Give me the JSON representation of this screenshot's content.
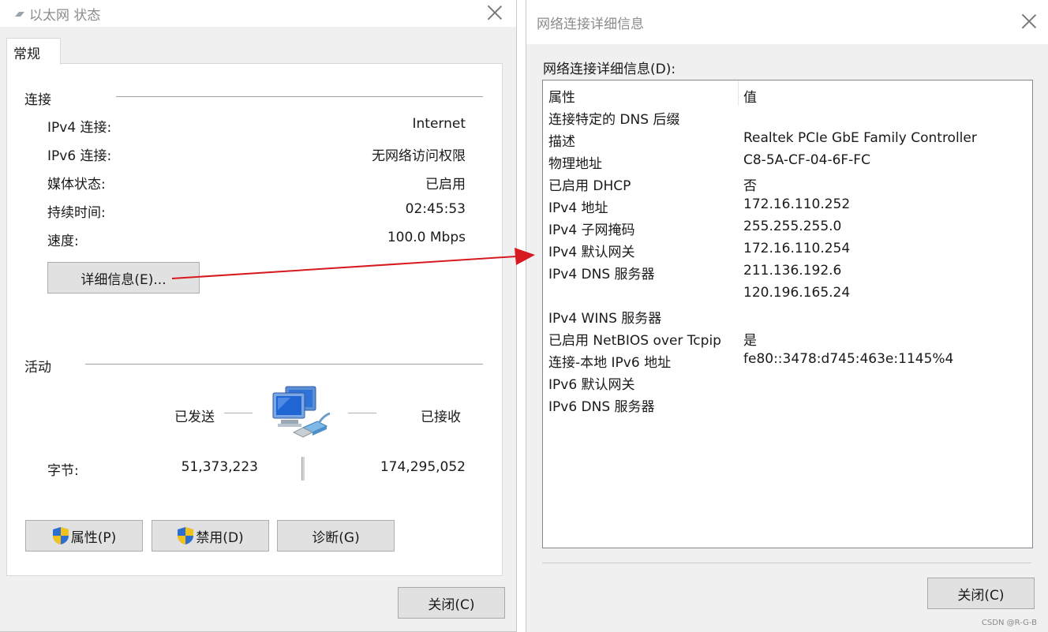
{
  "status_window": {
    "title": "以太网 状态",
    "tab_label": "常规",
    "connection": {
      "section_label": "连接",
      "rows": [
        {
          "label": "IPv4 连接:",
          "value": "Internet"
        },
        {
          "label": "IPv6 连接:",
          "value": "无网络访问权限"
        },
        {
          "label": "媒体状态:",
          "value": "已启用"
        },
        {
          "label": "持续时间:",
          "value": "02:45:53"
        },
        {
          "label": "速度:",
          "value": "100.0 Mbps"
        }
      ],
      "details_button": "详细信息(E)..."
    },
    "activity": {
      "section_label": "活动",
      "sent_label": "已发送",
      "received_label": "已接收",
      "bytes_label": "字节:",
      "bytes_sent": "51,373,223",
      "bytes_received": "174,295,052"
    },
    "buttons": {
      "properties": "属性(P)",
      "disable": "禁用(D)",
      "diagnose": "诊断(G)"
    },
    "close_button": "关闭(C)"
  },
  "details_window": {
    "title": "网络连接详细信息",
    "list_label": "网络连接详细信息(D):",
    "col_property": "属性",
    "col_value": "值",
    "rows": [
      {
        "property": "连接特定的 DNS 后缀",
        "value": ""
      },
      {
        "property": "描述",
        "value": "Realtek PCIe GbE Family Controller"
      },
      {
        "property": "物理地址",
        "value": "C8-5A-CF-04-6F-FC"
      },
      {
        "property": "已启用 DHCP",
        "value": "否"
      },
      {
        "property": "IPv4 地址",
        "value": "172.16.110.252"
      },
      {
        "property": "IPv4 子网掩码",
        "value": "255.255.255.0"
      },
      {
        "property": "IPv4 默认网关",
        "value": "172.16.110.254"
      },
      {
        "property": "IPv4 DNS 服务器",
        "value": "211.136.192.6"
      },
      {
        "property": "",
        "value": "120.196.165.24"
      },
      {
        "property": "IPv4 WINS 服务器",
        "value": ""
      },
      {
        "property": "已启用 NetBIOS over Tcpip",
        "value": "是"
      },
      {
        "property": "连接-本地 IPv6 地址",
        "value": "fe80::3478:d745:463e:1145%4"
      },
      {
        "property": "IPv6 默认网关",
        "value": ""
      },
      {
        "property": "IPv6 DNS 服务器",
        "value": ""
      }
    ],
    "close_button": "关闭(C)"
  },
  "watermark": "CSDN @R-G-B",
  "colors": {
    "arrow": "#d61a1f",
    "shield_blue": "#2d6fd0",
    "shield_yellow": "#f3c21a"
  }
}
